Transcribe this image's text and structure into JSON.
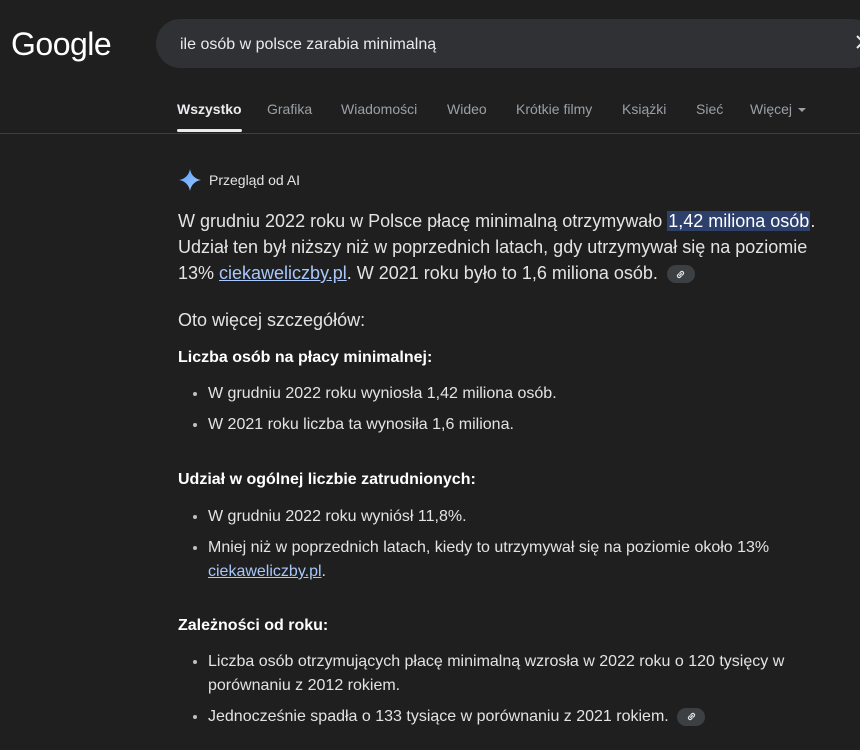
{
  "logo": "Google",
  "search": {
    "query": "ile osób w polsce zarabia minimalną"
  },
  "tabs": [
    "Wszystko",
    "Grafika",
    "Wiadomości",
    "Wideo",
    "Krótkie filmy",
    "Książki",
    "Sieć",
    "Więcej"
  ],
  "ai": {
    "header": "Przegląd od AI",
    "summary": {
      "p1": "W grudniu 2022 roku w Polsce płacę minimalną otrzymywało ",
      "highlight": "1,42 miliona osób",
      "p2": ". Udział ten był niższy niż w poprzednich latach, gdy utrzymywał się na poziomie 13% ",
      "link": "ciekaweliczby.pl",
      "p3": ". W 2021 roku było to 1,6 miliona osób."
    },
    "more": "Oto więcej szczegółów:",
    "sections": [
      {
        "title": "Liczba osób na płacy minimalnej:",
        "items": [
          "W grudniu 2022 roku wyniosła 1,42 miliona osób.",
          "W 2021 roku liczba ta wynosiła 1,6 miliona."
        ]
      },
      {
        "title": "Udział w ogólnej liczbie zatrudnionych:",
        "items": [
          "W grudniu 2022 roku wyniósł 11,8%.",
          "Mniej niż w poprzednich latach, kiedy to utrzymywał się na poziomie około 13% "
        ],
        "item2_link": "ciekaweliczby.pl",
        "item2_end": "."
      },
      {
        "title": "Zależności od roku:",
        "items": [
          "Liczba osób otrzymujących płacę minimalną wzrosła w 2022 roku o 120 tysięcy w porównaniu z 2012 rokiem.",
          "Jednocześnie spadła o 133 tysiące w porównaniu z 2021 rokiem."
        ]
      }
    ]
  },
  "colors": {
    "background": "#1f1f1f",
    "link": "#a8c7fa",
    "highlight": "#2d3f6b"
  },
  "icons": {
    "clear": "close-icon",
    "ai": "sparkle-icon",
    "source": "link-icon"
  }
}
